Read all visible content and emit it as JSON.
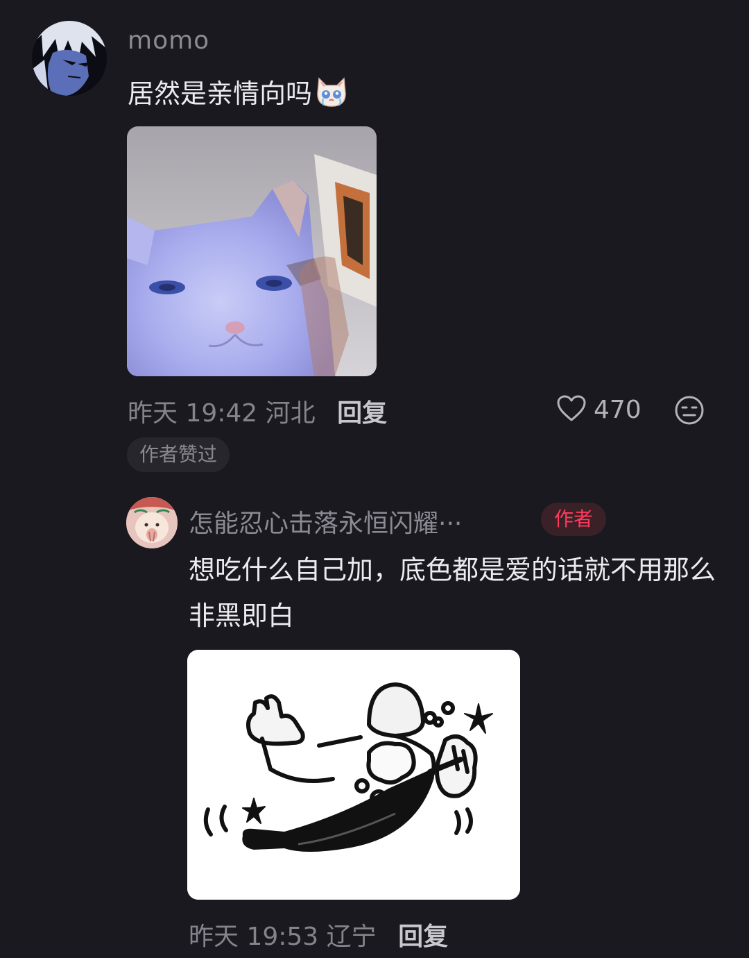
{
  "comments": [
    {
      "username": "momo",
      "text": "居然是亲情向吗",
      "inline_emoji": "crying-cat-emoji",
      "image": "blurry-cat-photo",
      "date": "昨天 19:42",
      "location": "河北",
      "reply_label": "回复",
      "likes": "470",
      "author_liked_label": "作者赞过"
    },
    {
      "username": "怎能忍心击落永恒闪耀···",
      "author_badge": "作者",
      "text": "想吃什么自己加，底色都是爱的话就不用那么非黑即白",
      "image": "cooking-wok-doodle",
      "date": "昨天 19:53",
      "location": "辽宁",
      "reply_label": "回复"
    }
  ],
  "colors": {
    "background": "#1a191f",
    "author_badge": "#ff3b5c",
    "muted_text": "#85848c"
  }
}
